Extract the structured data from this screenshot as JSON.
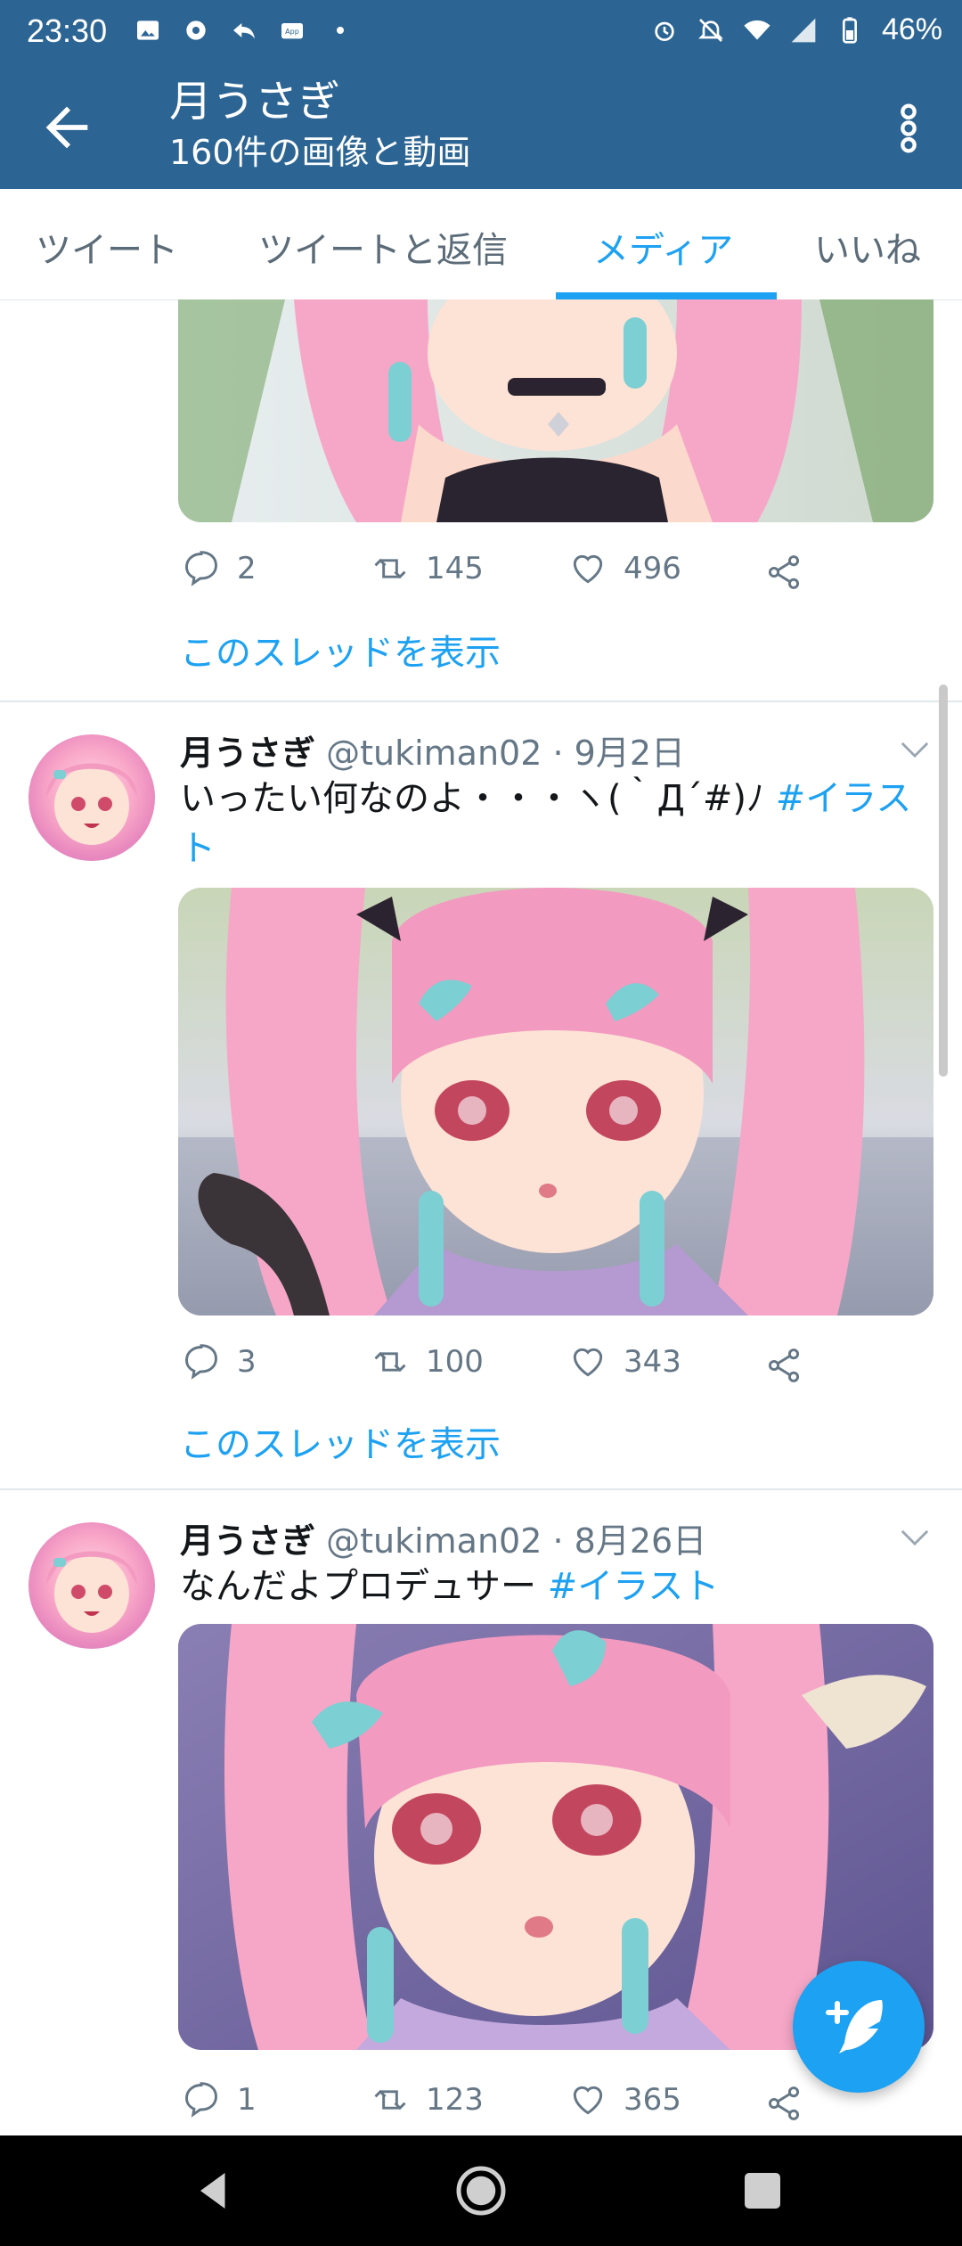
{
  "status": {
    "time": "23:30",
    "battery": "46%"
  },
  "appbar": {
    "title": "月うさぎ",
    "subtitle": "160件の画像と動画"
  },
  "tabs": [
    {
      "label": "ツイート"
    },
    {
      "label": "ツイートと返信"
    },
    {
      "label": "メディア",
      "active": true
    },
    {
      "label": "いいね"
    }
  ],
  "posts": [
    {
      "replies": "2",
      "retweets": "145",
      "likes": "496",
      "thread_link": "このスレッドを表示"
    },
    {
      "name": "月うさぎ",
      "handle": "@tukiman02",
      "date": "· 9月2日",
      "text": "いったい何なのよ・・・ヽ(｀Д´#)ﾉ ",
      "hashtag": "#イラスト",
      "replies": "3",
      "retweets": "100",
      "likes": "343",
      "thread_link": "このスレッドを表示"
    },
    {
      "name": "月うさぎ",
      "handle": "@tukiman02",
      "date": "· 8月26日",
      "text": "なんだよプロデュサー ",
      "hashtag": "#イラスト",
      "replies": "1",
      "retweets": "123",
      "likes": "365"
    }
  ],
  "colors": {
    "brand": "#2c6593",
    "accent": "#1da1f2",
    "muted": "#657786"
  },
  "icons": [
    "back-arrow-icon",
    "more-vert-icon",
    "reply-icon",
    "retweet-icon",
    "like-icon",
    "share-icon",
    "compose-icon"
  ]
}
